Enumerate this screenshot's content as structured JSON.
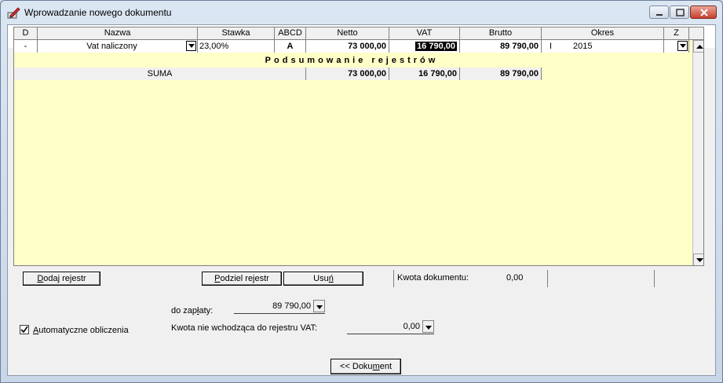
{
  "window": {
    "title": "Wprowadzanie nowego dokumentu"
  },
  "grid": {
    "columns": [
      "D",
      "Nazwa",
      "Stawka",
      "ABCD",
      "Netto",
      "VAT",
      "Brutto",
      "Okres",
      "Z"
    ],
    "row": {
      "d": "-",
      "nazwa": "Vat naliczony",
      "stawka": "23,00%",
      "abcd": "A",
      "netto": "73 000,00",
      "vat": "16 790,00",
      "brutto": "89 790,00",
      "okres_prefix": "I",
      "okres": "2015"
    },
    "summary_title": "Podsumowanie rejestrów",
    "sum": {
      "label": "SUMA",
      "netto": "73 000,00",
      "vat": "16 790,00",
      "brutto": "89 790,00"
    }
  },
  "toolbar": {
    "add_label_pre": "",
    "add_label_u": "D",
    "add_label_post": "odaj rejestr",
    "split_label_pre": "",
    "split_label_u": "P",
    "split_label_post": "odziel rejestr",
    "delete_label_pre": "Usu",
    "delete_label_u": "ń",
    "delete_label_post": "",
    "amount_label": "Kwota dokumentu:",
    "amount_value": "0,00"
  },
  "form": {
    "to_pay_label_pre": "do zap",
    "to_pay_label_u": "ł",
    "to_pay_label_post": "aty:",
    "to_pay_value": "89 790,00",
    "auto_label_pre": "",
    "auto_label_u": "A",
    "auto_label_post": "utomatyczne obliczenia",
    "auto_checked": true,
    "nonvat_label": "Kwota nie wchodząca do rejestru VAT:",
    "nonvat_value": "0,00"
  },
  "footer": {
    "back_pre": "<< Doku",
    "back_u": "m",
    "back_post": "ent"
  }
}
